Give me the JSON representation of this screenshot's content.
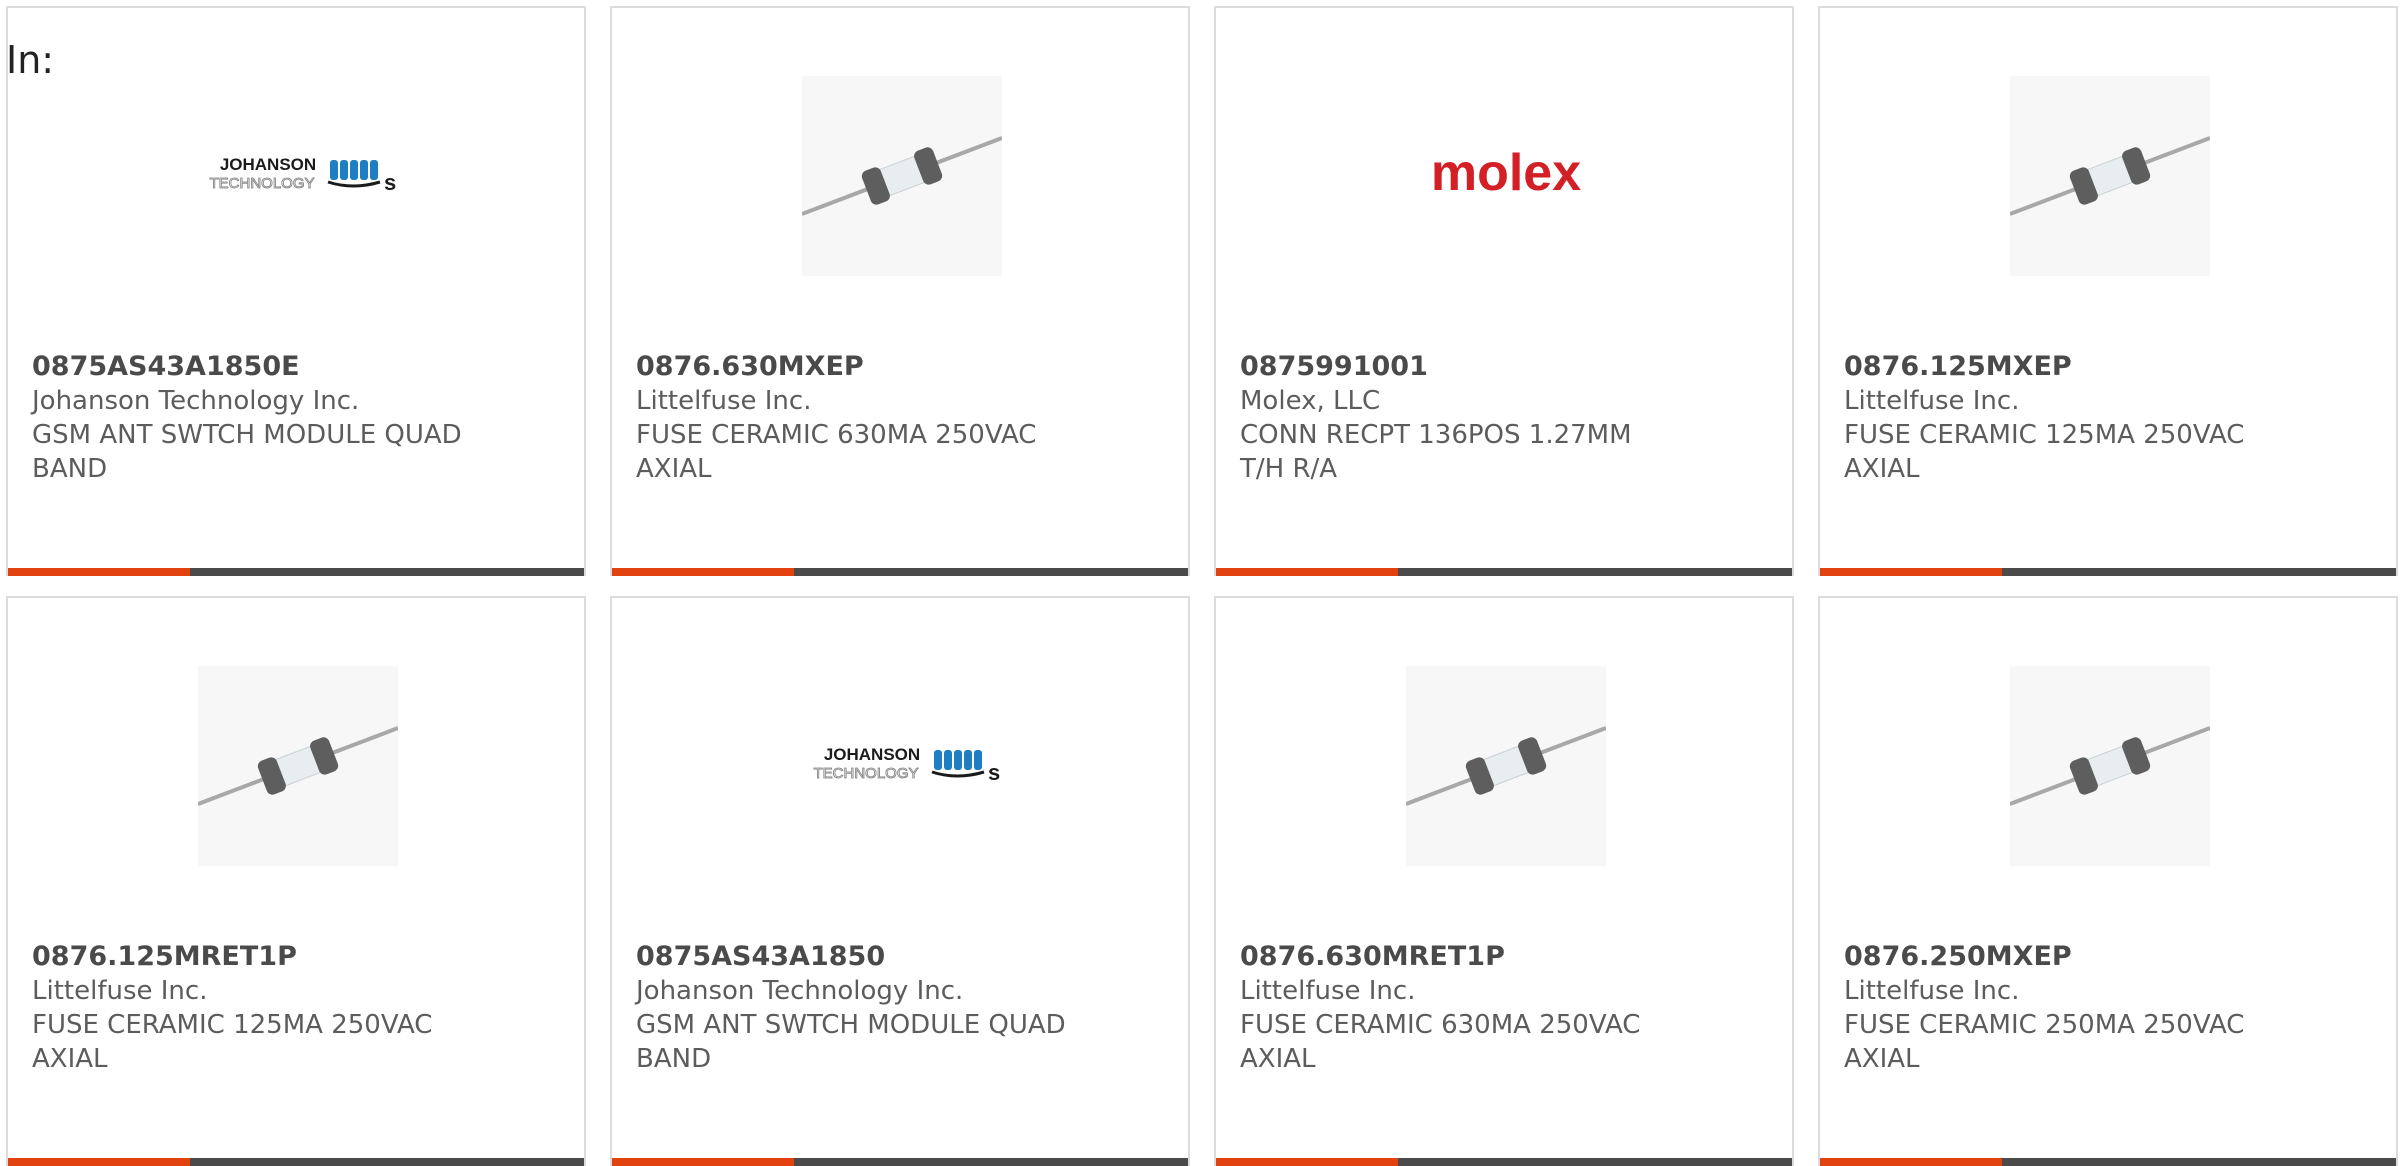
{
  "header": {
    "in_label": "In:"
  },
  "colors": {
    "accent": "#e2420f",
    "bar": "#4a4a4a",
    "molex_red": "#d31f26",
    "johanson_blue": "#1d7fc2"
  },
  "products": [
    {
      "part_number": "0875AS43A1850E",
      "manufacturer": "Johanson Technology Inc.",
      "description": "GSM ANT SWTCH MODULE QUAD BAND",
      "image": "johanson-logo",
      "logo_text": [
        "JOHANSON",
        "TECHNOLOGY"
      ]
    },
    {
      "part_number": "0876.630MXEP",
      "manufacturer": "Littelfuse Inc.",
      "description": "FUSE CERAMIC 630MA 250VAC AXIAL",
      "image": "axial-fuse"
    },
    {
      "part_number": "0875991001",
      "manufacturer": "Molex, LLC",
      "description": "CONN RECPT 136POS 1.27MM T/H R/A",
      "image": "molex-logo",
      "logo_text": [
        "molex"
      ]
    },
    {
      "part_number": "0876.125MXEP",
      "manufacturer": "Littelfuse Inc.",
      "description": "FUSE CERAMIC 125MA 250VAC AXIAL",
      "image": "axial-fuse"
    },
    {
      "part_number": "0876.125MRET1P",
      "manufacturer": "Littelfuse Inc.",
      "description": "FUSE CERAMIC 125MA 250VAC AXIAL",
      "image": "axial-fuse"
    },
    {
      "part_number": "0875AS43A1850",
      "manufacturer": "Johanson Technology Inc.",
      "description": "GSM ANT SWTCH MODULE QUAD BAND",
      "image": "johanson-logo",
      "logo_text": [
        "JOHANSON",
        "TECHNOLOGY"
      ]
    },
    {
      "part_number": "0876.630MRET1P",
      "manufacturer": "Littelfuse Inc.",
      "description": "FUSE CERAMIC 630MA 250VAC AXIAL",
      "image": "axial-fuse"
    },
    {
      "part_number": "0876.250MXEP",
      "manufacturer": "Littelfuse Inc.",
      "description": "FUSE CERAMIC 250MA 250VAC AXIAL",
      "image": "axial-fuse"
    }
  ]
}
